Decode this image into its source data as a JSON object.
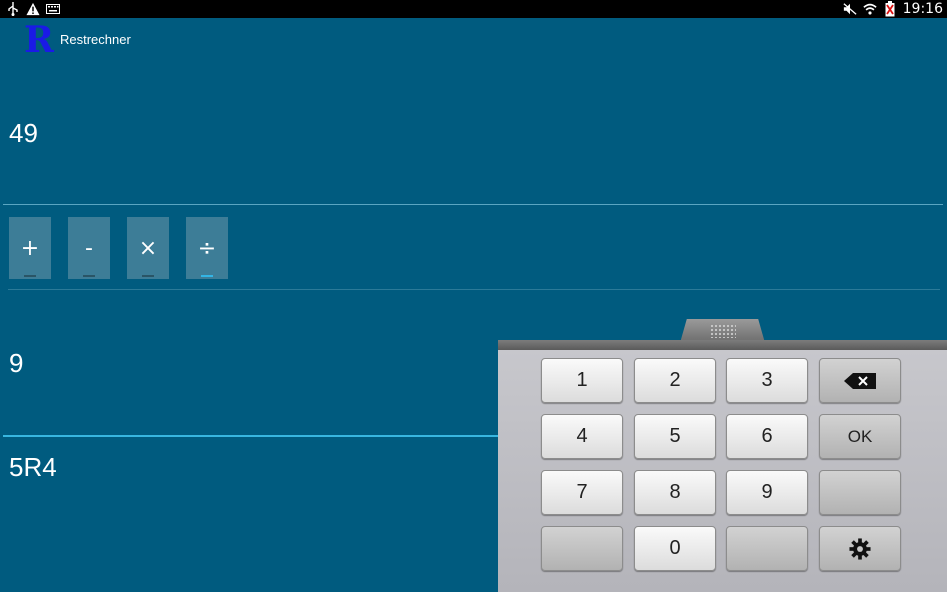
{
  "statusbar": {
    "left_icons": [
      "usb-icon",
      "warning-icon",
      "keyboard-icon"
    ],
    "right_icons": [
      "mute-icon",
      "wifi-icon",
      "battery-icon"
    ],
    "time": "19:16"
  },
  "actionbar": {
    "logo_letter": "R",
    "title": "Restrechner",
    "logo_color": "#1a1ae6"
  },
  "fields": {
    "dividend": "49",
    "divisor": "9",
    "result": "5R4"
  },
  "operators": [
    {
      "symbol": "+",
      "selected": false
    },
    {
      "symbol": "-",
      "selected": false
    },
    {
      "symbol": "×",
      "selected": false
    },
    {
      "symbol": "÷",
      "selected": true
    }
  ],
  "keyboard": {
    "keys": [
      "1",
      "2",
      "3",
      "4",
      "5",
      "6",
      "OK",
      "7",
      "8",
      "9",
      "0"
    ],
    "backspace_icon": "backspace-icon",
    "settings_icon": "gear-icon"
  },
  "colors": {
    "background": "#005b7f",
    "accent": "#33b5e5"
  }
}
